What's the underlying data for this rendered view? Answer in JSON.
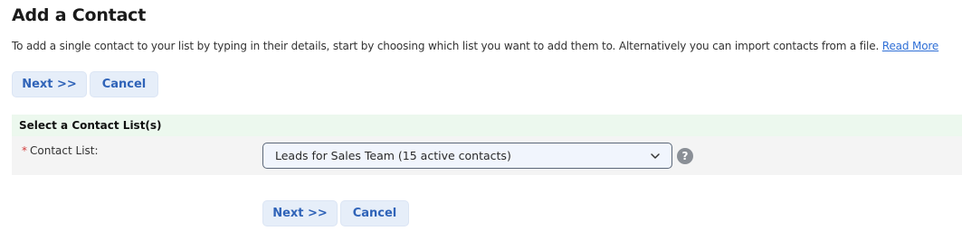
{
  "page": {
    "title": "Add a Contact",
    "intro_text": "To add a single contact to your list by typing in their details, start by choosing which list you want to add them to. Alternatively you can import contacts from a file.",
    "read_more_label": "Read More"
  },
  "buttons": {
    "next_label": "Next >>",
    "cancel_label": "Cancel"
  },
  "section": {
    "title": "Select a Contact List(s)",
    "field_label": "Contact List:",
    "required_marker": "*",
    "selected_value": "Leads for Sales Team (15 active contacts)",
    "help_glyph": "?"
  },
  "icons": {
    "dropdown": "chevron-down-icon",
    "help": "help-icon"
  },
  "colors": {
    "button_bg": "#e6eef9",
    "button_text": "#2f63b8",
    "link": "#2f6fd6",
    "section_header_bg": "#ecf8ee",
    "row_bg": "#f4f4f4",
    "required": "#d23b3b"
  }
}
